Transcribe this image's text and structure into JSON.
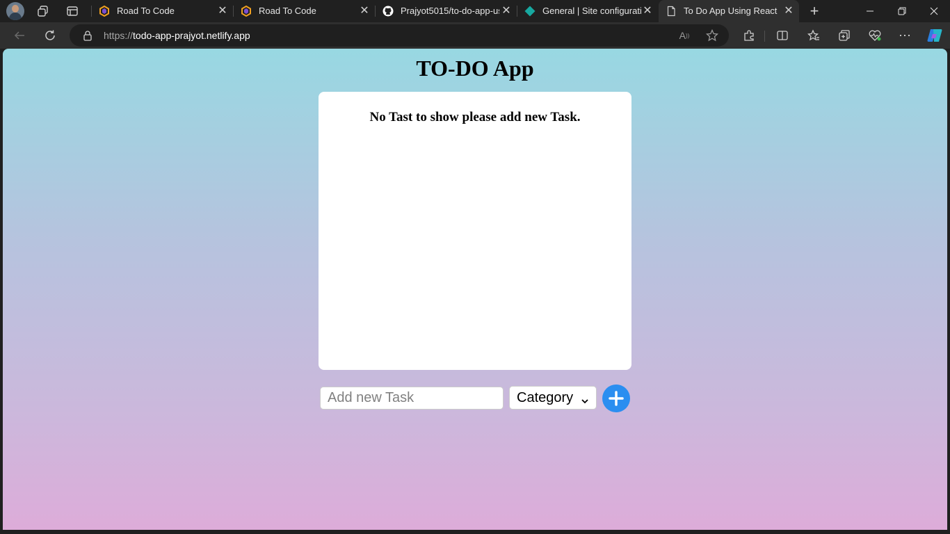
{
  "browser": {
    "tabs": [
      {
        "title": "Road To Code",
        "favicon": "road-to-code-favicon",
        "active": false
      },
      {
        "title": "Road To Code",
        "favicon": "road-to-code-favicon",
        "active": false
      },
      {
        "title": "Prajyot5015/to-do-app-us",
        "favicon": "github-favicon",
        "active": false
      },
      {
        "title": "General | Site configuratio",
        "favicon": "netlify-favicon",
        "active": false
      },
      {
        "title": "To Do App Using React",
        "favicon": "page-favicon",
        "active": true
      }
    ],
    "address": {
      "scheme": "https://",
      "host": "todo-app-prajyot.netlify.app"
    }
  },
  "app": {
    "title": "TO-DO App",
    "empty_message": "No Tast to show please add new Task.",
    "task_input_placeholder": "Add new Task",
    "category_selected": "Category"
  },
  "colors": {
    "gradient_top": "#98d8e2",
    "gradient_bottom": "#ddacd9",
    "add_button": "#2b8ef0",
    "browser_chrome": "#202020"
  }
}
